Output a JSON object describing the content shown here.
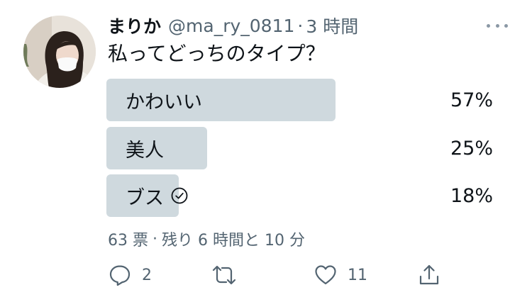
{
  "tweet": {
    "author_name": "まりか",
    "author_handle": "@ma_ry_0811",
    "separator": "·",
    "timestamp": "3 時間",
    "text": "私ってどっちのタイプ？"
  },
  "poll": {
    "options": [
      {
        "label": "かわいい",
        "percent": "57%",
        "fill_fraction": 0.57,
        "selected": false
      },
      {
        "label": "美人",
        "percent": "25%",
        "fill_fraction": 0.25,
        "selected": false
      },
      {
        "label": "ブス",
        "percent": "18%",
        "fill_fraction": 0.18,
        "selected": true
      }
    ],
    "votes": "63 票",
    "separator": "·",
    "remaining": "残り 6 時間と 10 分"
  },
  "actions": {
    "reply_count": "2",
    "retweet_count": "",
    "like_count": "11"
  },
  "colors": {
    "bar": "#cfd9de",
    "secondary_text": "#536471",
    "primary_text": "#0f1419"
  },
  "icons": {
    "more": "more-horizontal-icon",
    "check": "check-circle-icon",
    "reply": "reply-icon",
    "retweet": "retweet-icon",
    "like": "heart-icon",
    "share": "share-icon"
  }
}
